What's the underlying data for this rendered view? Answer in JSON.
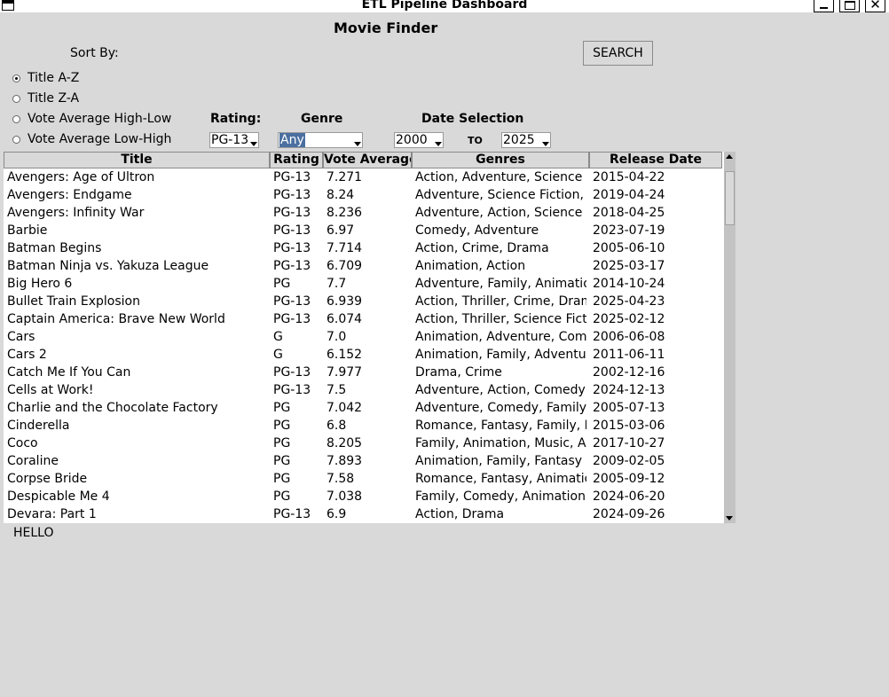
{
  "window": {
    "title": "ETL Pipeline Dashboard",
    "close_glyph": "✕"
  },
  "app": {
    "title": "Movie Finder",
    "sort_label": "Sort By:",
    "search_label": "SEARCH"
  },
  "sort_options": [
    {
      "label": "Title A-Z",
      "selected": true
    },
    {
      "label": "Title Z-A",
      "selected": false
    },
    {
      "label": "Vote Average High-Low",
      "selected": false
    },
    {
      "label": "Vote Average Low-High",
      "selected": false
    }
  ],
  "filters": {
    "rating_label": "Rating:",
    "genre_label": "Genre",
    "date_label": "Date Selection",
    "rating_value": "PG-13",
    "genre_value": "Any",
    "date_from": "2000",
    "to_label": "TO",
    "date_to": "2025"
  },
  "table": {
    "columns": [
      "Title",
      "Rating",
      "Vote Average",
      "Genres",
      "Release Date"
    ],
    "rows": [
      [
        "Avengers: Age of Ultron",
        "PG-13",
        "7.271",
        "Action, Adventure, Science Fiction",
        "2015-04-22"
      ],
      [
        "Avengers: Endgame",
        "PG-13",
        "8.24",
        "Adventure, Science Fiction, Action",
        "2019-04-24"
      ],
      [
        "Avengers: Infinity War",
        "PG-13",
        "8.236",
        "Adventure, Action, Science Fiction",
        "2018-04-25"
      ],
      [
        "Barbie",
        "PG-13",
        "6.97",
        "Comedy, Adventure",
        "2023-07-19"
      ],
      [
        "Batman Begins",
        "PG-13",
        "7.714",
        "Action, Crime, Drama",
        "2005-06-10"
      ],
      [
        "Batman Ninja vs. Yakuza League",
        "PG-13",
        "6.709",
        "Animation, Action",
        "2025-03-17"
      ],
      [
        "Big Hero 6",
        "PG",
        "7.7",
        "Adventure, Family, Animation",
        "2014-10-24"
      ],
      [
        "Bullet Train Explosion",
        "PG-13",
        "6.939",
        "Action, Thriller, Crime, Drama",
        "2025-04-23"
      ],
      [
        "Captain America: Brave New World",
        "PG-13",
        "6.074",
        "Action, Thriller, Science Fiction",
        "2025-02-12"
      ],
      [
        "Cars",
        "G",
        "7.0",
        "Animation, Adventure, Comedy",
        "2006-06-08"
      ],
      [
        "Cars 2",
        "G",
        "6.152",
        "Animation, Family, Adventure",
        "2011-06-11"
      ],
      [
        "Catch Me If You Can",
        "PG-13",
        "7.977",
        "Drama, Crime",
        "2002-12-16"
      ],
      [
        "Cells at Work!",
        "PG-13",
        "7.5",
        "Adventure, Action, Comedy, Fantasy",
        "2024-12-13"
      ],
      [
        "Charlie and the Chocolate Factory",
        "PG",
        "7.042",
        "Adventure, Comedy, Family, Fantasy",
        "2005-07-13"
      ],
      [
        "Cinderella",
        "PG",
        "6.8",
        "Romance, Fantasy, Family, Drama",
        "2015-03-06"
      ],
      [
        "Coco",
        "PG",
        "8.205",
        "Family, Animation, Music, Adventure",
        "2017-10-27"
      ],
      [
        "Coraline",
        "PG",
        "7.893",
        "Animation, Family, Fantasy",
        "2009-02-05"
      ],
      [
        "Corpse Bride",
        "PG",
        "7.58",
        "Romance, Fantasy, Animation",
        "2005-09-12"
      ],
      [
        "Despicable Me 4",
        "PG",
        "7.038",
        "Family, Comedy, Animation, Science Fiction",
        "2024-06-20"
      ],
      [
        "Devara: Part 1",
        "PG-13",
        "6.9",
        "Action, Drama",
        "2024-09-26"
      ]
    ]
  },
  "status": {
    "text": "HELLO"
  }
}
